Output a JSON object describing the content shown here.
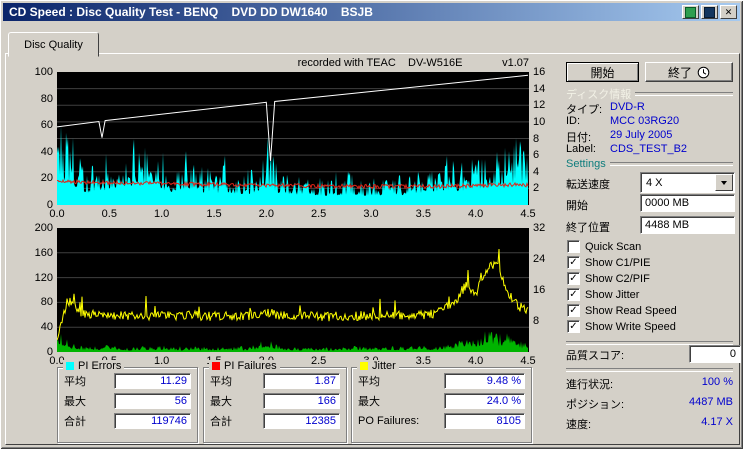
{
  "window": {
    "title": "CD Speed : Disc Quality Test - BENQ    DVD DD DW1640    BSJB"
  },
  "icons": {
    "close": "✕",
    "check": "✓"
  },
  "tab": {
    "label": "Disc Quality"
  },
  "header": {
    "recorded_with": "recorded with TEAC    DV-W516E",
    "version": "v1.07"
  },
  "actions": {
    "start_button": "開始",
    "exit_button": "終了"
  },
  "disc_info": {
    "section_title": "ディスク情報",
    "rows": [
      {
        "label": "タイプ:",
        "value": "DVD-R"
      },
      {
        "label": "ID:",
        "value": "MCC 03RG20"
      },
      {
        "label": "日付:",
        "value": "29 July 2005"
      },
      {
        "label": "Label:",
        "value": "CDS_TEST_B2"
      }
    ]
  },
  "settings": {
    "section_title": "Settings",
    "speed_label": "転送速度",
    "speed_value": "4 X",
    "start_label": "開始",
    "start_value": "0000 MB",
    "end_label": "終了位置",
    "end_value": "4488 MB",
    "checkboxes": [
      {
        "label": "Quick Scan",
        "checked": false
      },
      {
        "label": "Show C1/PIE",
        "checked": true
      },
      {
        "label": "Show C2/PIF",
        "checked": true
      },
      {
        "label": "Show Jitter",
        "checked": true
      },
      {
        "label": "Show Read Speed",
        "checked": true
      },
      {
        "label": "Show Write Speed",
        "checked": true
      }
    ]
  },
  "quality_score": {
    "label": "品質スコア:",
    "value": "0"
  },
  "status": [
    {
      "label": "進行状況:",
      "value": "100 %"
    },
    {
      "label": "ポジション:",
      "value": "4487 MB"
    },
    {
      "label": "速度:",
      "value": "4.17 X"
    }
  ],
  "stats": [
    {
      "title": "PI Errors",
      "color": "#00ffff",
      "rows": [
        {
          "label": "平均",
          "value": "11.29"
        },
        {
          "label": "最大",
          "value": "56"
        },
        {
          "label": "合計",
          "value": "119746"
        }
      ]
    },
    {
      "title": "PI Failures",
      "color": "#ff0000",
      "rows": [
        {
          "label": "平均",
          "value": "1.87"
        },
        {
          "label": "最大",
          "value": "166"
        },
        {
          "label": "合計",
          "value": "12385"
        }
      ]
    },
    {
      "title": "Jitter",
      "color": "#ffff00",
      "rows": [
        {
          "label": "平均",
          "value": "9.48 %"
        },
        {
          "label": "最大",
          "value": "24.0 %"
        },
        {
          "label": "PO Failures:",
          "value": "8105"
        }
      ]
    }
  ],
  "chart_data": [
    {
      "name": "top-chart",
      "type": "area",
      "x_axis": {
        "range": [
          0,
          4.5
        ],
        "ticks": [
          "0.0",
          "0.5",
          "1.0",
          "1.5",
          "2.0",
          "2.5",
          "3.0",
          "3.5",
          "4.0",
          "4.5"
        ]
      },
      "left_axis": {
        "range": [
          0,
          100
        ],
        "ticks": [
          0,
          20,
          40,
          60,
          80,
          100
        ]
      },
      "right_axis": {
        "range": [
          0,
          16
        ],
        "ticks": [
          2,
          4,
          6,
          8,
          10,
          12,
          14,
          16
        ]
      },
      "grid_axis": "right",
      "grid_values": [
        2,
        4,
        6,
        8,
        10,
        12,
        14
      ],
      "series": [
        {
          "name": "pi-errors",
          "color": "#00ffff",
          "axis": "left",
          "style": "area",
          "x_step": 0.1,
          "values": [
            62,
            48,
            30,
            26,
            34,
            30,
            42,
            38,
            45,
            40,
            32,
            28,
            34,
            30,
            26,
            24,
            28,
            24,
            22,
            26,
            44,
            26,
            24,
            22,
            24,
            20,
            19,
            21,
            23,
            20,
            19,
            21,
            23,
            21,
            23,
            26,
            28,
            30,
            28,
            31,
            33,
            36,
            39,
            44,
            46,
            42
          ]
        },
        {
          "name": "pi-failures-line",
          "color": "#e02418",
          "axis": "left",
          "style": "line",
          "noise": 3,
          "x_step": 0.25,
          "values": [
            17.5,
            17.2,
            16.8,
            16.5,
            16.2,
            15.8,
            15.3,
            15.0,
            14.8,
            14.6,
            14.3,
            14.1,
            14.0,
            14.0,
            14.0,
            14.2,
            14.5,
            15.2,
            15.0
          ]
        },
        {
          "name": "write-speed",
          "color": "#ffffff",
          "axis": "right",
          "style": "line",
          "noise": 0,
          "points": [
            [
              0,
              9.4
            ],
            [
              0.4,
              10.05
            ],
            [
              0.43,
              8.1
            ],
            [
              0.46,
              10.15
            ],
            [
              2.0,
              12.35
            ],
            [
              2.04,
              5.3
            ],
            [
              2.08,
              12.45
            ],
            [
              4.5,
              15.6
            ]
          ]
        }
      ]
    },
    {
      "name": "bottom-chart",
      "type": "area",
      "x_axis": {
        "range": [
          0,
          4.5
        ],
        "ticks": [
          "0.0",
          "0.5",
          "1.0",
          "1.5",
          "2.0",
          "2.5",
          "3.0",
          "3.5",
          "4.0",
          "4.5"
        ]
      },
      "left_axis": {
        "range": [
          0,
          200
        ],
        "ticks": [
          0,
          40,
          80,
          120,
          160,
          200
        ]
      },
      "right_axis": {
        "range": [
          0,
          32
        ],
        "ticks": [
          8,
          16,
          24,
          32
        ]
      },
      "grid_axis": "left",
      "grid_values": [
        40,
        80,
        120,
        160
      ],
      "series": [
        {
          "name": "pi-failures-area",
          "color": "#00b400",
          "axis": "left",
          "style": "area",
          "x_step": 0.1,
          "values": [
            36,
            18,
            10,
            8,
            9,
            12,
            8,
            7,
            9,
            8,
            10,
            8,
            7,
            9,
            8,
            7,
            8,
            9,
            7,
            10,
            22,
            12,
            8,
            7,
            8,
            7,
            6,
            8,
            7,
            8,
            7,
            8,
            9,
            8,
            9,
            10,
            9,
            12,
            15,
            25,
            20,
            34,
            26,
            30,
            18,
            12
          ]
        },
        {
          "name": "jitter",
          "color": "#ffff00",
          "axis": "right",
          "style": "line",
          "noise": 2.4,
          "spikes": true,
          "x_step": 0.1,
          "values": [
            3,
            13.5,
            10.5,
            9.8,
            9.6,
            9.4,
            9.5,
            9.3,
            9.6,
            9.4,
            9.5,
            9.3,
            9.4,
            9.6,
            9.3,
            9.2,
            9.4,
            9.3,
            9.2,
            9.5,
            10.5,
            9.6,
            9.4,
            9.3,
            9.4,
            9.2,
            9.1,
            9.3,
            9.2,
            9.4,
            9.2,
            9.3,
            9.5,
            9.4,
            9.6,
            9.5,
            10.0,
            11.0,
            13.0,
            17.0,
            15.0,
            21.0,
            23.5,
            16.0,
            12.0,
            10.5
          ]
        }
      ]
    }
  ]
}
